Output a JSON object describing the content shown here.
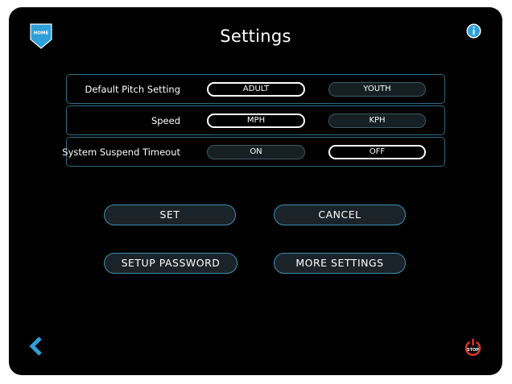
{
  "app": {
    "title": "Settings",
    "home_label": "HOME",
    "stop_label": "STOP"
  },
  "icons": {
    "home": "home-badge-icon",
    "info": "info-icon",
    "back": "chevron-left-icon",
    "stop": "power-stop-icon"
  },
  "colors": {
    "background": "#000000",
    "accent": "#2e9fd8",
    "border": "#2c6d86",
    "stop": "#d9362b"
  },
  "settings_rows": [
    {
      "label": "Default Pitch Setting",
      "option_left": "ADULT",
      "option_right": "YOUTH",
      "selected": "ADULT"
    },
    {
      "label": "Speed",
      "option_left": "MPH",
      "option_right": "KPH",
      "selected": "MPH"
    },
    {
      "label": "System Suspend Timeout",
      "option_left": "ON",
      "option_right": "OFF",
      "selected": "OFF"
    }
  ],
  "buttons": {
    "set": "SET",
    "cancel": "CANCEL",
    "setup_password": "SETUP PASSWORD",
    "more_settings": "MORE SETTINGS"
  }
}
